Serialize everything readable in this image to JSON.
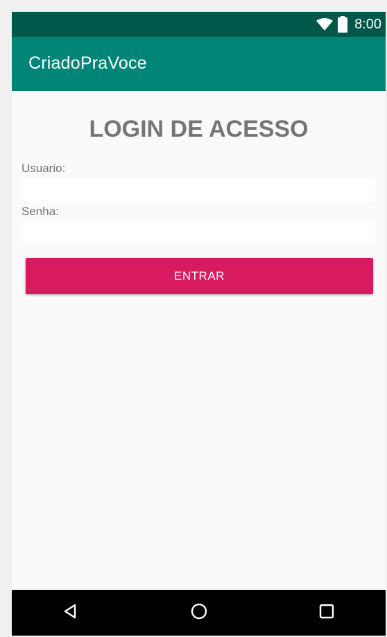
{
  "status_bar": {
    "time": "8:00",
    "icons": [
      "wifi-icon",
      "battery-icon"
    ]
  },
  "app_bar": {
    "title": "CriadoPraVoce"
  },
  "login": {
    "heading": "LOGIN DE ACESSO",
    "username_label": "Usuario:",
    "username_value": "",
    "password_label": "Senha:",
    "password_value": "",
    "submit_label": "ENTRAR"
  },
  "nav_bar": {
    "buttons": [
      "back-icon",
      "home-icon",
      "recents-icon"
    ]
  },
  "colors": {
    "status_bar": "#00574b",
    "app_bar": "#008577",
    "accent": "#d81b60",
    "background": "#fafafa"
  }
}
